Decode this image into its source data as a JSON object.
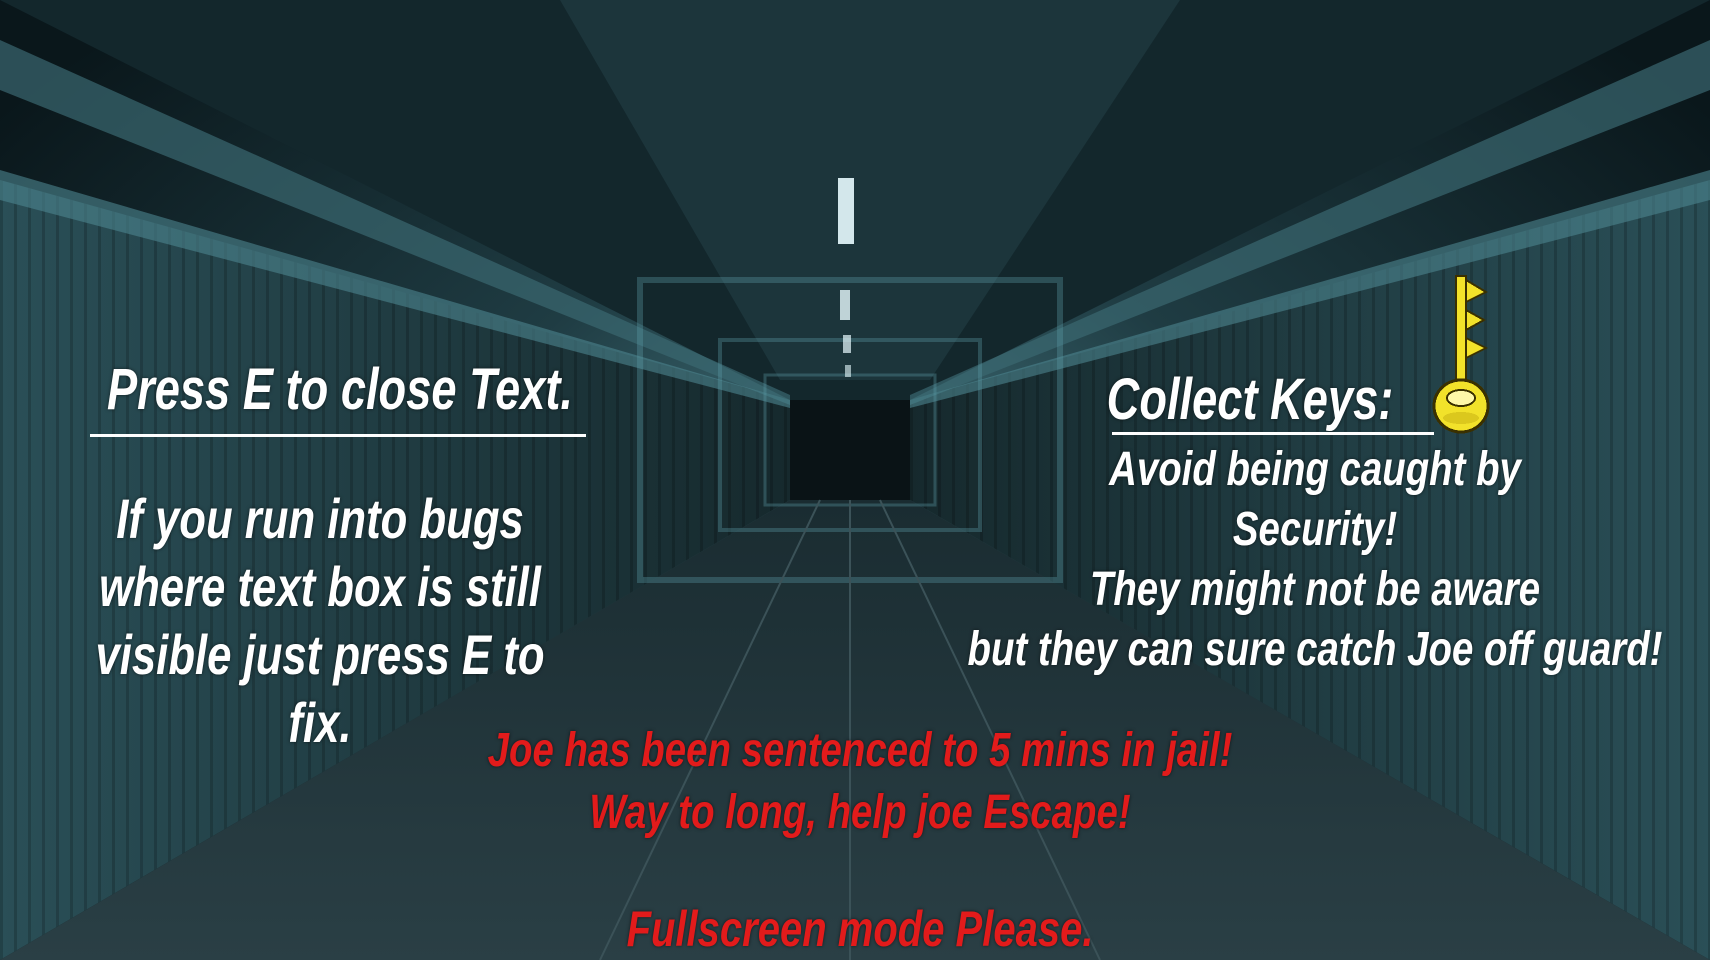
{
  "left_panel": {
    "title": "Press E to close Text.",
    "bug_help_lines": [
      "If you run into bugs",
      "where text box is still",
      "visible just press E to",
      "fix."
    ]
  },
  "right_panel": {
    "title": "Collect Keys:",
    "key_icon": "key-icon",
    "warning_lines": [
      "Avoid being caught by",
      "Security!",
      "They might not be aware",
      "but they can sure catch Joe off guard!"
    ]
  },
  "story": {
    "lines": [
      "Joe has been sentenced to 5 mins in jail!",
      "Way to long, help joe Escape!"
    ],
    "fullscreen_note": "Fullscreen mode Please."
  },
  "colors": {
    "text_white": "#ffffff",
    "text_red": "#e21b1b",
    "key_gold": "#f2e22a",
    "background": "#0c1a1e"
  }
}
